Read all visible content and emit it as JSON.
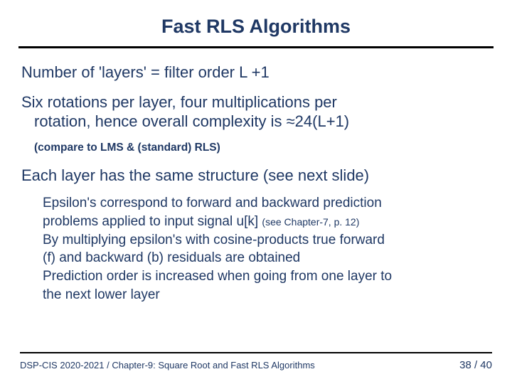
{
  "title": "Fast RLS Algorithms",
  "line1": "Number of 'layers' = filter order L +1",
  "line2a": "Six rotations per layer, four multiplications per",
  "line2b": "rotation, hence overall complexity is ≈24(L+1)",
  "sub1": "(compare to LMS & (standard) RLS)",
  "line3": "Each layer has the same structure (see next slide)",
  "d1": "Epsilon's correspond to forward and backward prediction",
  "d2a": "problems applied to input signal u[k] ",
  "d2b": "(see Chapter-7, p. 12)",
  "d3": "By multiplying epsilon's with cosine-products true forward",
  "d4": "(f) and backward (b) residuals are obtained",
  "d5": "Prediction order is increased when going from one layer to",
  "d6": "the next lower layer",
  "footer_left": "DSP-CIS 2020-2021 / Chapter-9: Square Root and Fast RLS Algorithms",
  "footer_right": "38 / 40"
}
